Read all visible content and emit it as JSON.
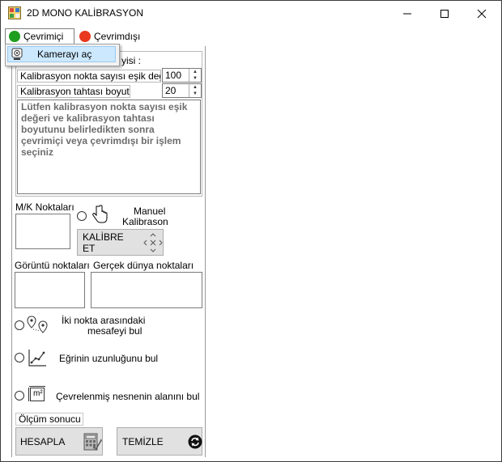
{
  "window": {
    "title": "2D MONO KALİBRASYON",
    "minimize_symbol": "—",
    "maximize_symbol": "☐",
    "close_symbol": "✕"
  },
  "menu": {
    "online_label": "Çevrimiçi",
    "offline_label": "Çevrimdışı",
    "online_color": "#1e9e1e",
    "offline_color": "#e8391f",
    "dropdown_item_label": "Kamerayı aç",
    "dropdown_item_icon": "webcam-icon"
  },
  "calibration": {
    "point_count_label_tail": "yisi :",
    "threshold_label": "Kalibrasyon nokta sayısı eşik değeri :",
    "threshold_value": "100",
    "board_size_label": "Kalibrasyon tahtası boyutu :",
    "board_size_value": "20",
    "info_text": "Lütfen kalibrasyon nokta sayısı eşik değeri ve kalibrasyon tahtası boyutunu belirledikten sonra çevrimiçi veya çevrimdışı bir işlem seçiniz"
  },
  "mk": {
    "label": "M/K Noktaları",
    "manual_label_line1": "Manuel",
    "manual_label_line2": "Kalibrason",
    "calibrate_button": "KALİBRE ET"
  },
  "points": {
    "image_points_label": "Görüntü noktaları",
    "world_points_label": "Gerçek dünya noktaları"
  },
  "measure": {
    "distance_line1": "İki nokta arasındaki",
    "distance_line2": "mesafeyi bul",
    "curve_label": "Eğrinin uzunluğunu bul",
    "area_label": "Çevrelenmiş nesnenin alanını bul",
    "area_icon_text": "m²",
    "result_label": "Ölçüm sonucu :",
    "calculate_button": "HESAPLA",
    "clear_button": "TEMİZLE"
  }
}
